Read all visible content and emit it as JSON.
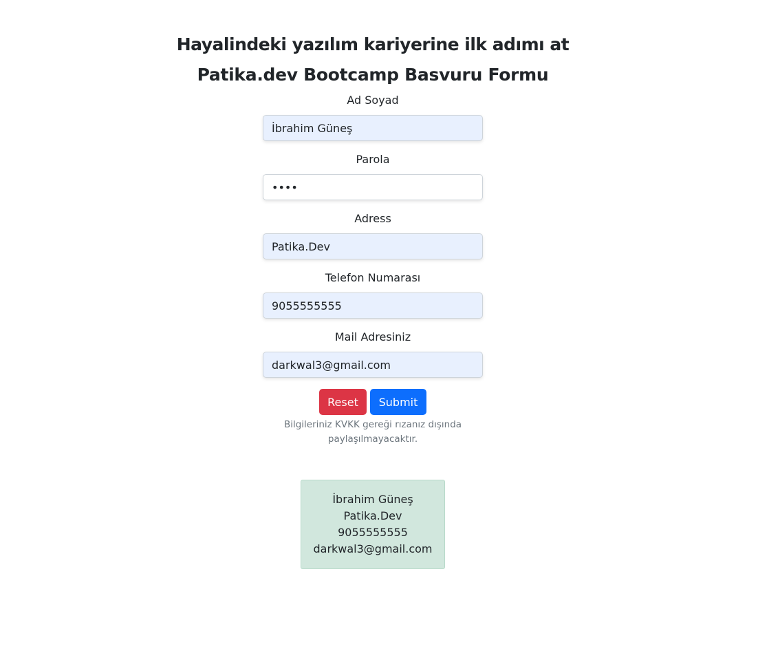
{
  "header": {
    "title_line1": "Hayalindeki yazılım kariyerine ilk adımı at",
    "title_line2": "Patika.dev Bootcamp Basvuru Formu"
  },
  "form": {
    "name_label": "Ad Soyad",
    "name_value": "İbrahim Güneş",
    "password_label": "Parola",
    "password_value": "1234",
    "address_label": "Adress",
    "address_value": "Patika.Dev",
    "phone_label": "Telefon Numarası",
    "phone_value": "9055555555",
    "email_label": "Mail Adresiniz",
    "email_value": "darkwal3@gmail.com",
    "reset_label": "Reset",
    "submit_label": "Submit",
    "privacy_note": "Bilgileriniz KVKK gereği rızanız dışında paylaşılmayacaktır."
  },
  "summary": {
    "name": "İbrahim Güneş",
    "address": "Patika.Dev",
    "phone": "9055555555",
    "email": "darkwal3@gmail.com"
  },
  "colors": {
    "reset_button": "#dc3545",
    "submit_button": "#0d6efd",
    "summary_background": "#d1e7dd",
    "autofill_background": "#e8f0fe"
  }
}
